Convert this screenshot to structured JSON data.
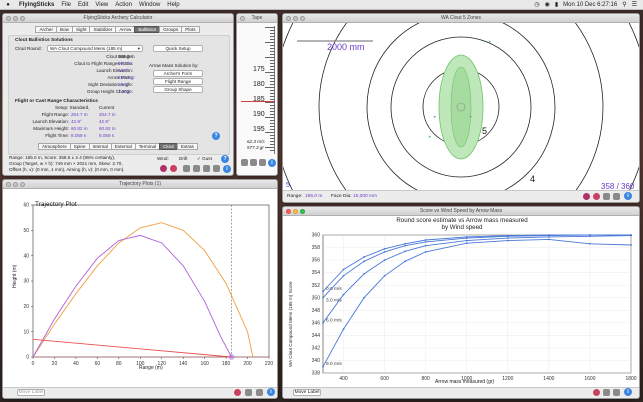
{
  "menubar": {
    "app": "FlyingSticks",
    "items": [
      "File",
      "Edit",
      "View",
      "Action",
      "Window",
      "Help"
    ],
    "clock": "Mon 10 Dec 6:27:16"
  },
  "calc": {
    "title": "FlyingSticks Archery Calculator",
    "tabs": [
      "Archer",
      "Bow",
      "Sight",
      "Stabilizer",
      "Arrow",
      "Ballistics",
      "Groups",
      "Plots"
    ],
    "active_tab": "Ballistics",
    "sol_heading": "Clout Ballistics Solutions",
    "clout_round_label": "Clout Round:",
    "clout_round_value": "WA Clout Compound Mens (185 m)",
    "quick_setup": "Quick Setup",
    "rows": [
      {
        "label": "Clout Range:",
        "value": "185.0 m"
      },
      {
        "label": "Clout to Flight Ranges Ratio:",
        "value": "90.7 %"
      },
      {
        "label": "Launch Elevation:",
        "value": "16.7°"
      },
      {
        "label": "Arrow Mass:",
        "value": "577.3 gr"
      },
      {
        "label": "Sight Deviation Angle:",
        "value": "10.0°"
      },
      {
        "label": "Group Height Change:",
        "value": "1.703"
      }
    ],
    "mass_solution": "Arrow Mass Solution by:",
    "archers_form": "Archer's Form",
    "flight_range": "Flight Range",
    "group_shape": "Group Shape",
    "flight_heading": "Flight or Cast Range Characteristics",
    "col_standard": "Setup: Standard,",
    "col_current": "Current",
    "flight_rows": [
      {
        "label": "Flight Range:",
        "standard": "204.7 m",
        "current": "204.7 m"
      },
      {
        "label": "Launch Elevation:",
        "standard": "42.9°",
        "current": "42.9°"
      },
      {
        "label": "Maximum Height:",
        "standard": "60.82 m",
        "current": "60.82 m"
      },
      {
        "label": "Flight Time:",
        "standard": "8.059 s",
        "current": "8.059 s"
      }
    ],
    "bottom_tabs": [
      "Atmosphere",
      "Spine",
      "Internal",
      "External",
      "Terminal",
      "Clout",
      "Extras"
    ],
    "active_bottom_tab": "Clout",
    "info": [
      "Range: 185.0 m, Score: 358.5 ± 2.4 (95% certainty),",
      "Group (Target, w × h): 749 mm × 2021 mm, Skew: 2.70,",
      "Offset (h, v): (0 mm, 1 mm), Aiming (h, v): (0 mm, 0 mm)."
    ],
    "wind_label": "Wind:",
    "drift_label": "Drift",
    "gust_label": "Gust"
  },
  "tape": {
    "title": "Tape",
    "marks": [
      "175",
      "180",
      "185",
      "190",
      "195"
    ],
    "readout1": "62.3 m/s",
    "readout2": "577.3 gr"
  },
  "zones": {
    "title": "WA Clout 5 Zones",
    "distance": "2000 mm",
    "ring_labels": [
      "5",
      "4"
    ],
    "corner_left": "5",
    "range_label": "Range:",
    "range_value": "185.0 m",
    "face_label": "Face Dia:",
    "face_value": "15,000 mm",
    "score": "358 / 360"
  },
  "traj": {
    "title": "Trajectory Plots (1)",
    "plot_title": "Trajectory Plot",
    "ylabel": "Height (m)",
    "xlabel": "Range (m)",
    "footer": "Move Label",
    "chart_data": {
      "type": "line",
      "title": "Trajectory Plot",
      "xlabel": "Range (m)",
      "ylabel": "Height (m)",
      "xlim": [
        0,
        220
      ],
      "ylim": [
        0,
        60
      ],
      "xticks": [
        0,
        20,
        40,
        60,
        80,
        100,
        120,
        140,
        160,
        180,
        200,
        220
      ],
      "yticks": [
        0,
        10,
        20,
        30,
        40,
        50,
        60
      ],
      "series": [
        {
          "color": "#f0a040",
          "x": [
            0,
            20,
            40,
            60,
            80,
            100,
            120,
            140,
            160,
            180,
            200,
            205
          ],
          "y": [
            0,
            13,
            25,
            36,
            45,
            51,
            53,
            50,
            42,
            29,
            10,
            0
          ]
        },
        {
          "color": "#b060d8",
          "x": [
            0,
            20,
            40,
            60,
            80,
            100,
            120,
            140,
            160,
            175,
            185
          ],
          "y": [
            0,
            15,
            28,
            39,
            46,
            48,
            45,
            36,
            22,
            8,
            0
          ]
        },
        {
          "color": "#e85050",
          "x": [
            0,
            185
          ],
          "y": [
            7,
            0
          ]
        }
      ]
    }
  },
  "score": {
    "title": "Score vs Wind Speed by Arrow Mass",
    "footer": "Move Label",
    "chart_data": {
      "type": "line",
      "title": "Round score estimate vs Arrow mass measured\nby Wind speed",
      "xlabel": "Arrow mass measured (gr)",
      "ylabel": "WA Clout Compound Mens (185 m) Score",
      "xlim": [
        300,
        1800
      ],
      "ylim": [
        338,
        360
      ],
      "xticks": [
        400,
        600,
        800,
        1000,
        1200,
        1400,
        1600,
        1800
      ],
      "yticks": [
        338,
        340,
        342,
        344,
        346,
        348,
        350,
        352,
        354,
        356,
        358,
        360
      ],
      "series": [
        {
          "name": "0.0 m/s",
          "x": [
            300,
            400,
            500,
            600,
            700,
            800,
            1000,
            1200,
            1400,
            1600,
            1800
          ],
          "y": [
            351,
            354.5,
            356.5,
            357.8,
            358.6,
            359.2,
            359.7,
            359.9,
            360,
            360,
            360
          ]
        },
        {
          "name": "3.0 m/s",
          "x": [
            300,
            400,
            500,
            600,
            700,
            800,
            1000,
            1200,
            1400,
            1600,
            1800
          ],
          "y": [
            350,
            353.5,
            355.8,
            357.3,
            358.3,
            358.9,
            359.5,
            359.8,
            359.9,
            360,
            360
          ]
        },
        {
          "name": "6.0 m/s",
          "x": [
            300,
            400,
            500,
            600,
            700,
            800,
            1000,
            1200,
            1400,
            1600,
            1800
          ],
          "y": [
            346,
            350.5,
            353.8,
            356,
            357.4,
            358.3,
            359.1,
            359.5,
            359.7,
            359.8,
            359.9
          ]
        },
        {
          "name": "9.0 m/s",
          "x": [
            300,
            400,
            500,
            600,
            700,
            800,
            1000,
            1200,
            1400,
            1600,
            1800
          ],
          "y": [
            339,
            345,
            350,
            353.5,
            355.8,
            357.3,
            358.7,
            359.1,
            359.3,
            358.6,
            358.4
          ]
        }
      ]
    }
  },
  "colors": {
    "accent": "#3a86e0",
    "value": "#6a3ec8",
    "orange": "#f0a040",
    "purple": "#b060d8",
    "red": "#e85050",
    "green": "#9fdc9a",
    "series_blue": "#4a78d8"
  }
}
